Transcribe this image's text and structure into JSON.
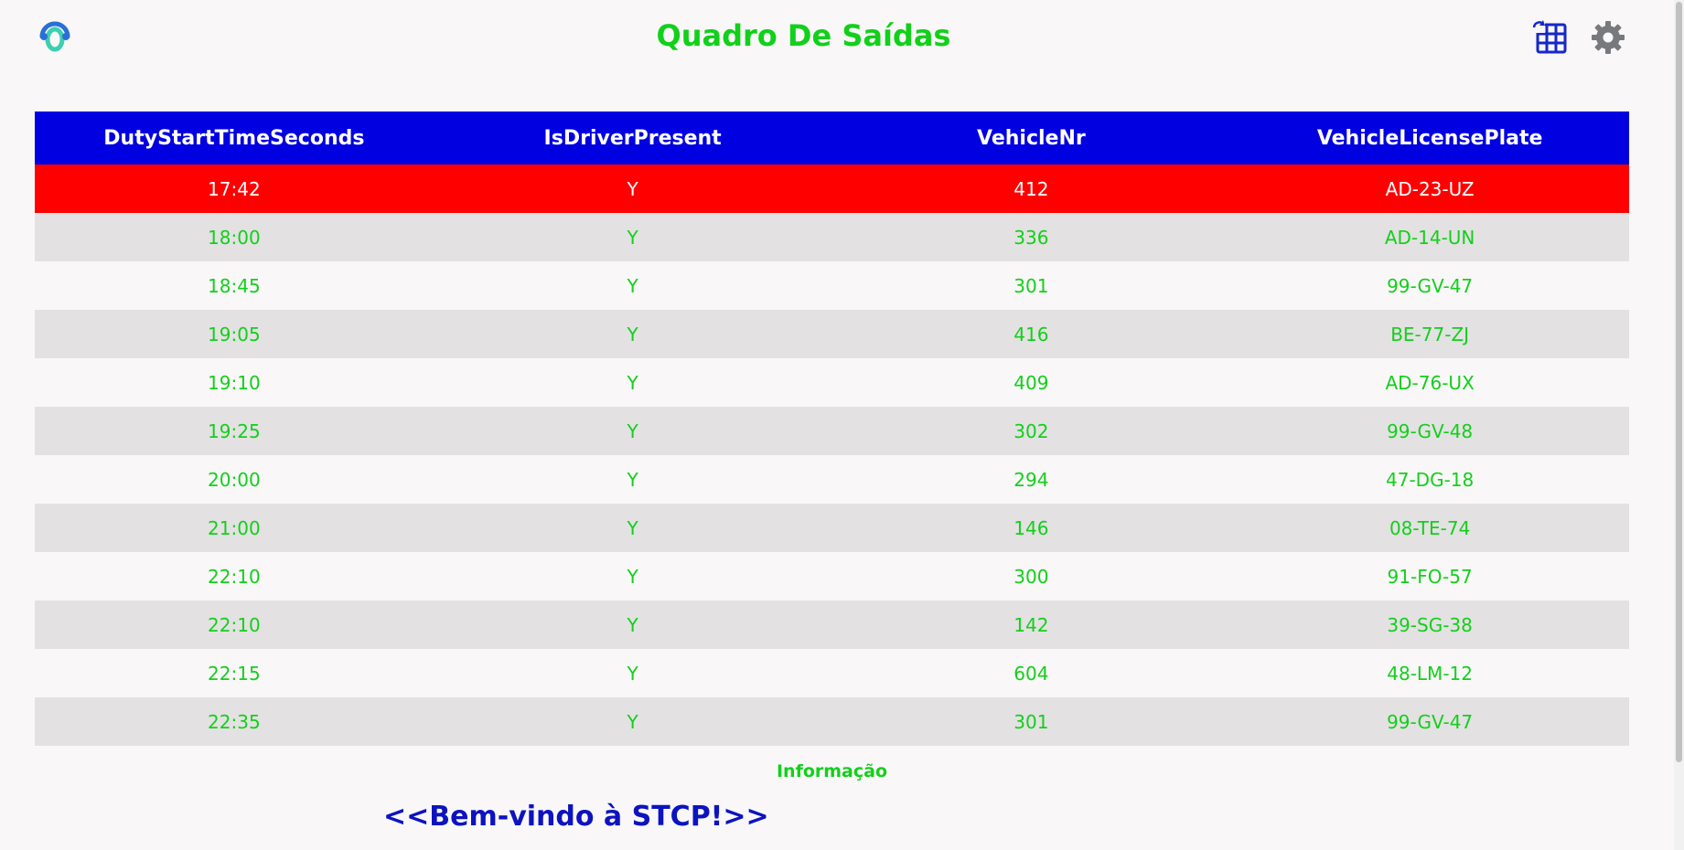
{
  "header": {
    "title": "Quadro De Saídas",
    "logo_icon": "headset-logo-icon",
    "grid_button_icon": "table-refresh-icon",
    "settings_button_icon": "gear-icon"
  },
  "colors": {
    "title": "#12d01a",
    "header_bg": "#0000e0",
    "alert_row": "#ff0000",
    "ticker": "#0c13bf"
  },
  "table": {
    "columns": [
      "DutyStartTimeSeconds",
      "IsDriverPresent",
      "VehicleNr",
      "VehicleLicensePlate"
    ],
    "rows": [
      {
        "time": "17:42",
        "driver": "Y",
        "vehicle": "412",
        "plate": "AD-23-UZ",
        "status": "alert"
      },
      {
        "time": "18:00",
        "driver": "Y",
        "vehicle": "336",
        "plate": "AD-14-UN",
        "status": "normal"
      },
      {
        "time": "18:45",
        "driver": "Y",
        "vehicle": "301",
        "plate": "99-GV-47",
        "status": "normal"
      },
      {
        "time": "19:05",
        "driver": "Y",
        "vehicle": "416",
        "plate": "BE-77-ZJ",
        "status": "normal"
      },
      {
        "time": "19:10",
        "driver": "Y",
        "vehicle": "409",
        "plate": "AD-76-UX",
        "status": "normal"
      },
      {
        "time": "19:25",
        "driver": "Y",
        "vehicle": "302",
        "plate": "99-GV-48",
        "status": "normal"
      },
      {
        "time": "20:00",
        "driver": "Y",
        "vehicle": "294",
        "plate": "47-DG-18",
        "status": "normal"
      },
      {
        "time": "21:00",
        "driver": "Y",
        "vehicle": "146",
        "plate": "08-TE-74",
        "status": "normal"
      },
      {
        "time": "22:10",
        "driver": "Y",
        "vehicle": "300",
        "plate": "91-FO-57",
        "status": "normal"
      },
      {
        "time": "22:10",
        "driver": "Y",
        "vehicle": "142",
        "plate": "39-SG-38",
        "status": "normal"
      },
      {
        "time": "22:15",
        "driver": "Y",
        "vehicle": "604",
        "plate": "48-LM-12",
        "status": "normal"
      },
      {
        "time": "22:35",
        "driver": "Y",
        "vehicle": "301",
        "plate": "99-GV-47",
        "status": "normal"
      }
    ]
  },
  "footer": {
    "label": "Informação",
    "ticker": "<<Bem-vindo à STCP!>>"
  }
}
